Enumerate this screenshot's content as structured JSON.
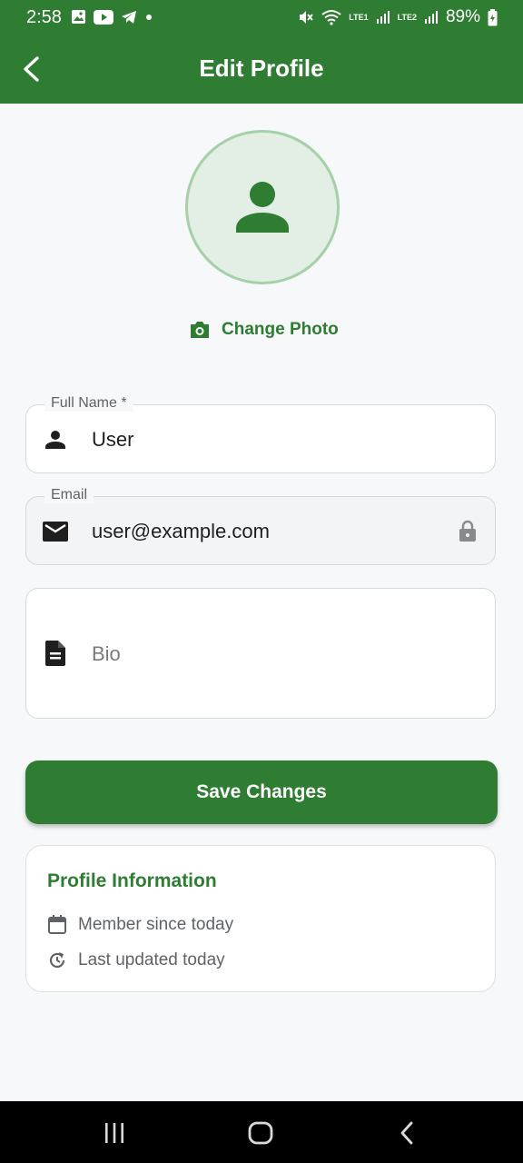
{
  "status_bar": {
    "time": "2:58",
    "battery": "89%",
    "sim1": "LTE1",
    "sim2": "LTE2",
    "icons": [
      "gallery-icon",
      "youtube-icon",
      "telegram-icon",
      "dot-icon",
      "mute-icon",
      "wifi-icon",
      "signal-icon",
      "battery-icon"
    ]
  },
  "app_bar": {
    "title": "Edit Profile",
    "back_icon": "back-arrow-icon",
    "background": "#2e7d32"
  },
  "avatar": {
    "icon": "person-icon",
    "change_photo_label": "Change Photo",
    "change_photo_icon": "camera-icon"
  },
  "form": {
    "full_name": {
      "label": "Full Name *",
      "value": "User",
      "icon": "person-icon"
    },
    "email": {
      "label": "Email",
      "value": "user@example.com",
      "icon": "mail-icon",
      "locked": true
    },
    "bio": {
      "placeholder": "Bio",
      "icon": "document-icon"
    }
  },
  "save_button": {
    "label": "Save Changes"
  },
  "profile_info": {
    "title": "Profile Information",
    "member_since": "Member since today",
    "last_updated": "Last updated today"
  },
  "colors": {
    "primary": "#2e7d32",
    "page_background": "#f6f8f9",
    "avatar_fill": "#e3efe4",
    "avatar_border": "#a5d0a8"
  }
}
